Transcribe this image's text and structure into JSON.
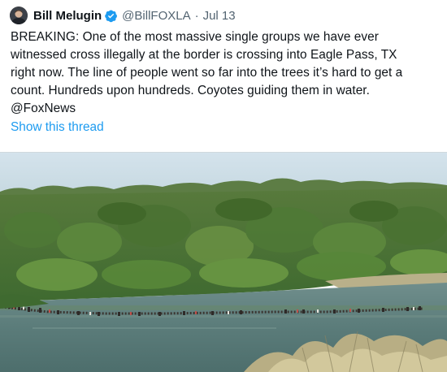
{
  "tweet": {
    "author_name": "Bill Melugin",
    "handle": "@BillFOXLA",
    "separator": "·",
    "date": "Jul 13",
    "text": "BREAKING: One of the most massive single groups we have ever\nwitnessed cross illegally at the border is crossing into Eagle Pass, TX\nright now. The line of people went so far into the trees it’s hard to get a\ncount. Hundreds upon hundreds. Coyotes guiding them in water.\n@FoxNews",
    "thread_link": "Show this thread",
    "verified_color": "#1d9bf0",
    "link_color": "#1d9bf0"
  },
  "icons": {
    "verified": "verified-badge-icon",
    "avatar": "profile-photo"
  }
}
